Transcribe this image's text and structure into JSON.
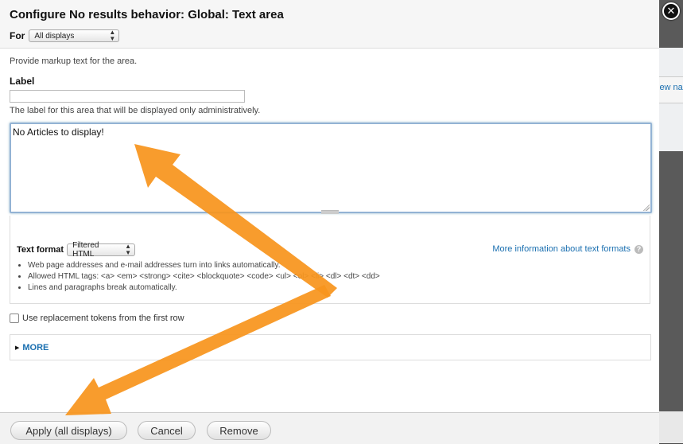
{
  "dialog": {
    "title": "Configure No results behavior: Global: Text area",
    "for_label": "For",
    "for_select": {
      "value": "All displays"
    },
    "description": "Provide markup text for the area.",
    "label_field": {
      "label": "Label",
      "value": "",
      "help": "The label for this area that will be displayed only administratively."
    },
    "textarea": {
      "value": "No Articles to display!"
    },
    "text_format": {
      "label": "Text format",
      "select_value": "Filtered HTML",
      "more_info": "More information about text formats",
      "tips": [
        "Web page addresses and e-mail addresses turn into links automatically.",
        "Allowed HTML tags: <a> <em> <strong> <cite> <blockquote> <code> <ul> <ol> <li> <dl> <dt> <dd>",
        "Lines and paragraphs break automatically."
      ]
    },
    "tokens_checkbox": {
      "label": "Use replacement tokens from the first row",
      "checked": false
    },
    "more": {
      "label": "MORE"
    },
    "buttons": {
      "apply": "Apply (all displays)",
      "cancel": "Cancel",
      "remove": "Remove"
    }
  },
  "background": {
    "link_fragment": "iew na"
  },
  "annotation": {
    "arrow_color": "#f7941d"
  },
  "icons": {
    "close": "close-icon",
    "help": "help-icon",
    "select_arrows": "updown-arrows-icon",
    "disclosure": "triangle-right-icon"
  }
}
